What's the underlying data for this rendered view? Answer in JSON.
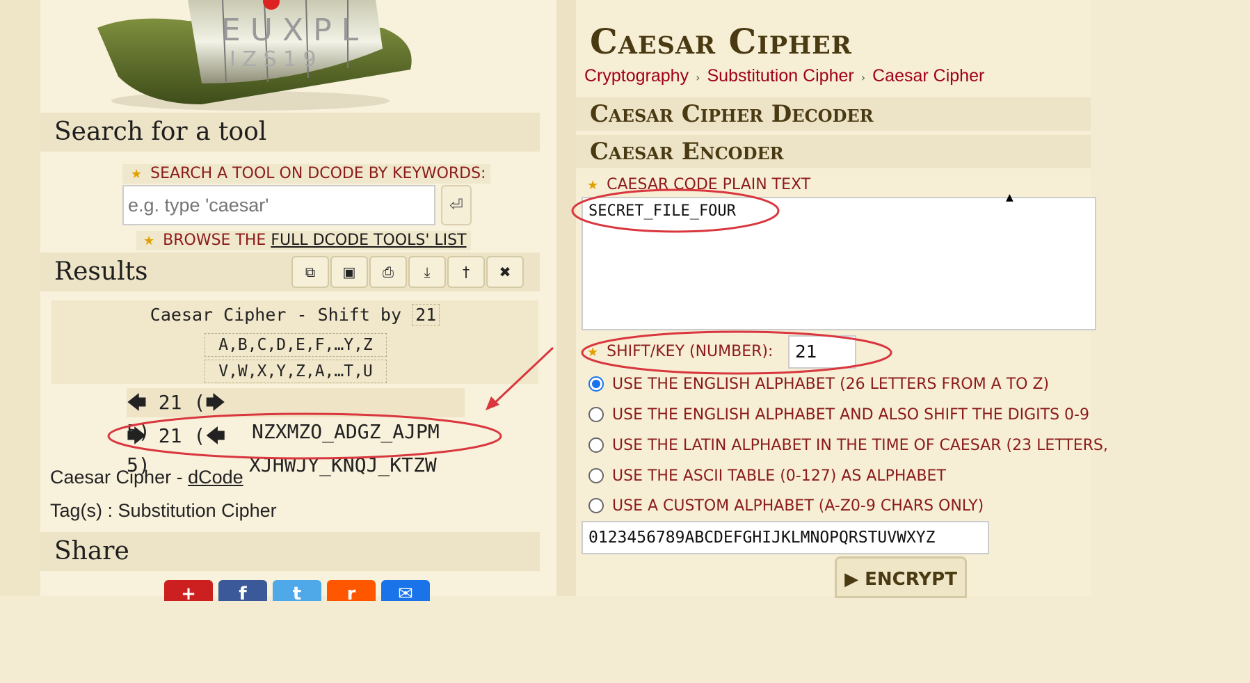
{
  "search": {
    "title": "Search for a tool",
    "label": "SEARCH A TOOL ON DCODE BY KEYWORDS:",
    "placeholder": "e.g. type 'caesar'",
    "go_icon": "⏎",
    "browse_prefix": "BROWSE THE ",
    "browse_link": "FULL DCODE TOOLS' LIST"
  },
  "results": {
    "title": "Results",
    "toolbar": [
      {
        "icon": "copy-icon",
        "glyph": "⧉"
      },
      {
        "icon": "save-icon",
        "glyph": "▣"
      },
      {
        "icon": "print-icon",
        "glyph": "⎙"
      },
      {
        "icon": "download-icon",
        "glyph": "⤓"
      },
      {
        "icon": "pin-icon",
        "glyph": "†"
      },
      {
        "icon": "close-icon",
        "glyph": "✖"
      }
    ],
    "heading_prefix": "Caesar Cipher - Shift by ",
    "shift": "21",
    "alphabet_plain": "A,B,C,D,E,F,…Y,Z",
    "alphabet_cipher": "V,W,X,Y,Z,A,…T,U",
    "rows": [
      {
        "direction": "🡄 21 (🡆 5)",
        "output": "NZXMZO_ADGZ_AJPM"
      },
      {
        "direction": "🡆 21 (🡄 5)",
        "output": "XJHWJY_KNQJ_KTZW"
      }
    ],
    "credit_prefix": "Caesar Cipher - ",
    "credit_link": "dCode",
    "tags": "Tag(s) : Substitution Cipher"
  },
  "share": {
    "title": "Share",
    "buttons": [
      {
        "color": "#cc1f1f",
        "glyph": "+"
      },
      {
        "color": "#3b5998",
        "glyph": "f"
      },
      {
        "color": "#4fa8e8",
        "glyph": "t"
      },
      {
        "color": "#ff5700",
        "glyph": "r"
      },
      {
        "color": "#1a73e8",
        "glyph": "✉"
      }
    ]
  },
  "page": {
    "title": "Caesar Cipher",
    "breadcrumbs": [
      "Cryptography",
      "Substitution Cipher",
      "Caesar Cipher"
    ],
    "decoder_title": "Caesar Cipher Decoder",
    "encoder_title": "Caesar Encoder",
    "plain_label": "CAESAR CODE PLAIN TEXT",
    "plain_text": "SECRET_FILE_FOUR",
    "shift_label": "SHIFT/KEY (NUMBER):",
    "shift_value": "21",
    "options": [
      {
        "label": "USE THE ENGLISH ALPHABET (26 LETTERS FROM A TO Z)",
        "selected": true
      },
      {
        "label": "USE THE ENGLISH ALPHABET AND ALSO SHIFT THE DIGITS 0-9",
        "selected": false
      },
      {
        "label": "USE THE LATIN ALPHABET IN THE TIME OF CAESAR (23 LETTERS,",
        "selected": false
      },
      {
        "label": "USE THE ASCII TABLE (0-127) AS ALPHABET",
        "selected": false
      },
      {
        "label": "USE A CUSTOM ALPHABET (A-Z0-9 CHARS ONLY)",
        "selected": false
      }
    ],
    "custom_alphabet": "0123456789ABCDEFGHIJKLMNOPQRSTUVWXYZ",
    "encrypt_label": "▶ ENCRYPT"
  },
  "colors": {
    "accent_red": "#a0001a",
    "annotation": "#d9363e",
    "radio_blue": "#1a73e8"
  }
}
